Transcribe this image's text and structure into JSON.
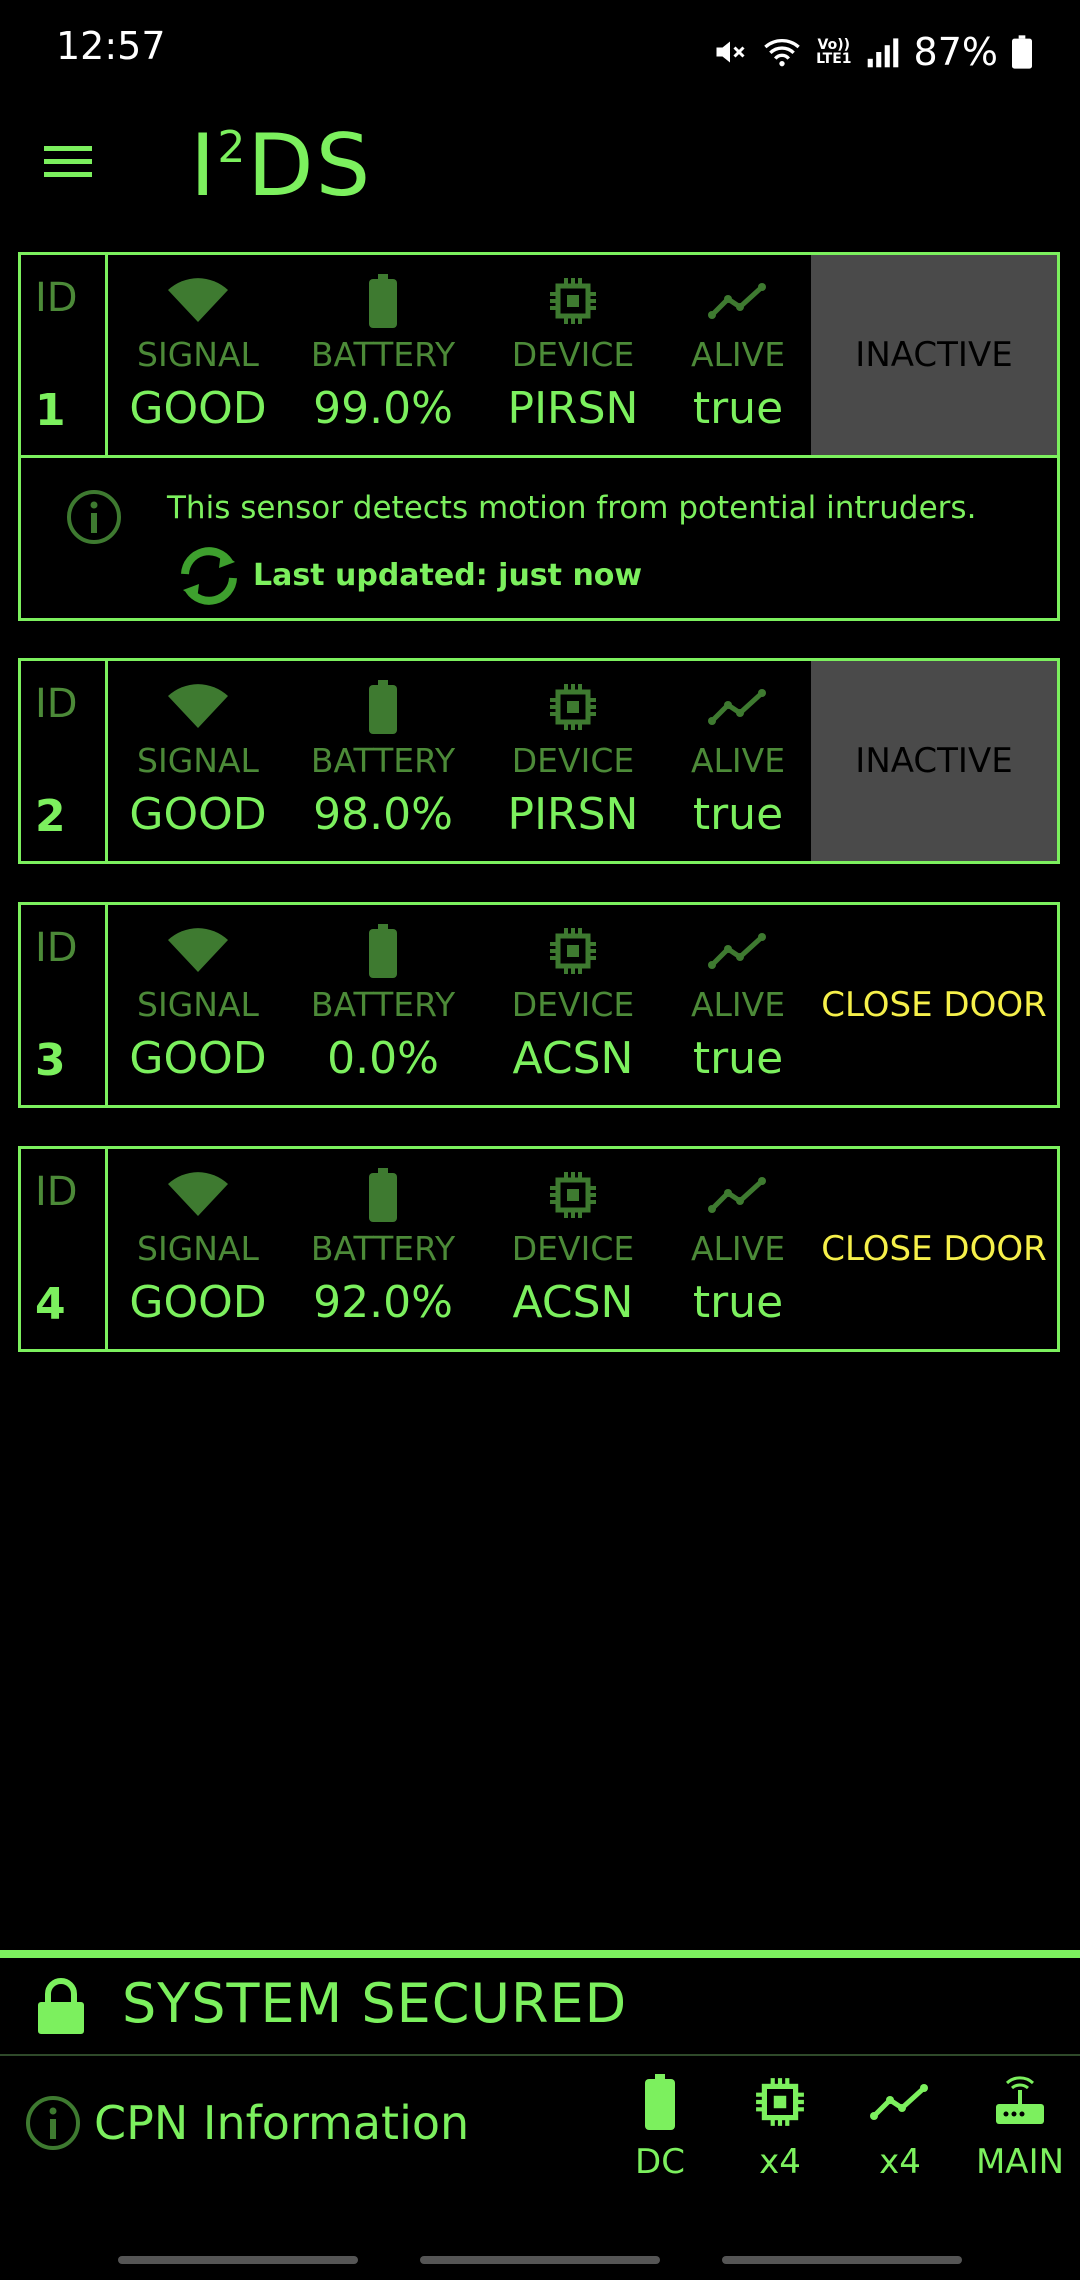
{
  "status_bar": {
    "time": "12:57",
    "lte_top": "Vo))",
    "lte_bottom": "LTE1",
    "battery_percent": "87%",
    "icons": [
      "mute-icon",
      "wifi-icon",
      "volte-icon",
      "cell-signal-icon",
      "battery-icon"
    ]
  },
  "app": {
    "title_main": "I",
    "title_sup": "2",
    "title_rest": "DS",
    "menu_icon": "hamburger-menu-icon"
  },
  "labels": {
    "id": "ID",
    "signal": "SIGNAL",
    "battery": "BATTERY",
    "device": "DEVICE",
    "alive": "ALIVE"
  },
  "sensors": [
    {
      "id": "1",
      "signal": "GOOD",
      "battery": "99.0%",
      "device": "PIRSN",
      "alive": "true",
      "action": "INACTIVE",
      "info": "This sensor detects motion from potential intruders.",
      "updated": "Last updated: just now"
    },
    {
      "id": "2",
      "signal": "GOOD",
      "battery": "98.0%",
      "device": "PIRSN",
      "alive": "true",
      "action": "INACTIVE"
    },
    {
      "id": "3",
      "signal": "GOOD",
      "battery": "0.0%",
      "device": "ACSN",
      "alive": "true",
      "action": "CLOSE DOOR"
    },
    {
      "id": "4",
      "signal": "GOOD",
      "battery": "92.0%",
      "device": "ACSN",
      "alive": "true",
      "action": "CLOSE DOOR"
    }
  ],
  "system": {
    "status": "SYSTEM SECURED"
  },
  "cpn": {
    "label": "CPN Information",
    "stats": [
      {
        "icon": "battery-icon",
        "label": "DC"
      },
      {
        "icon": "chip-icon",
        "label": "x4"
      },
      {
        "icon": "trend-icon",
        "label": "x4"
      },
      {
        "icon": "router-icon",
        "label": "MAIN"
      }
    ]
  },
  "colors": {
    "green": "#7CF05E",
    "dim_green": "#4C8A38",
    "yellow": "#F6F04A",
    "inactive_bg": "#4a4a4a"
  }
}
